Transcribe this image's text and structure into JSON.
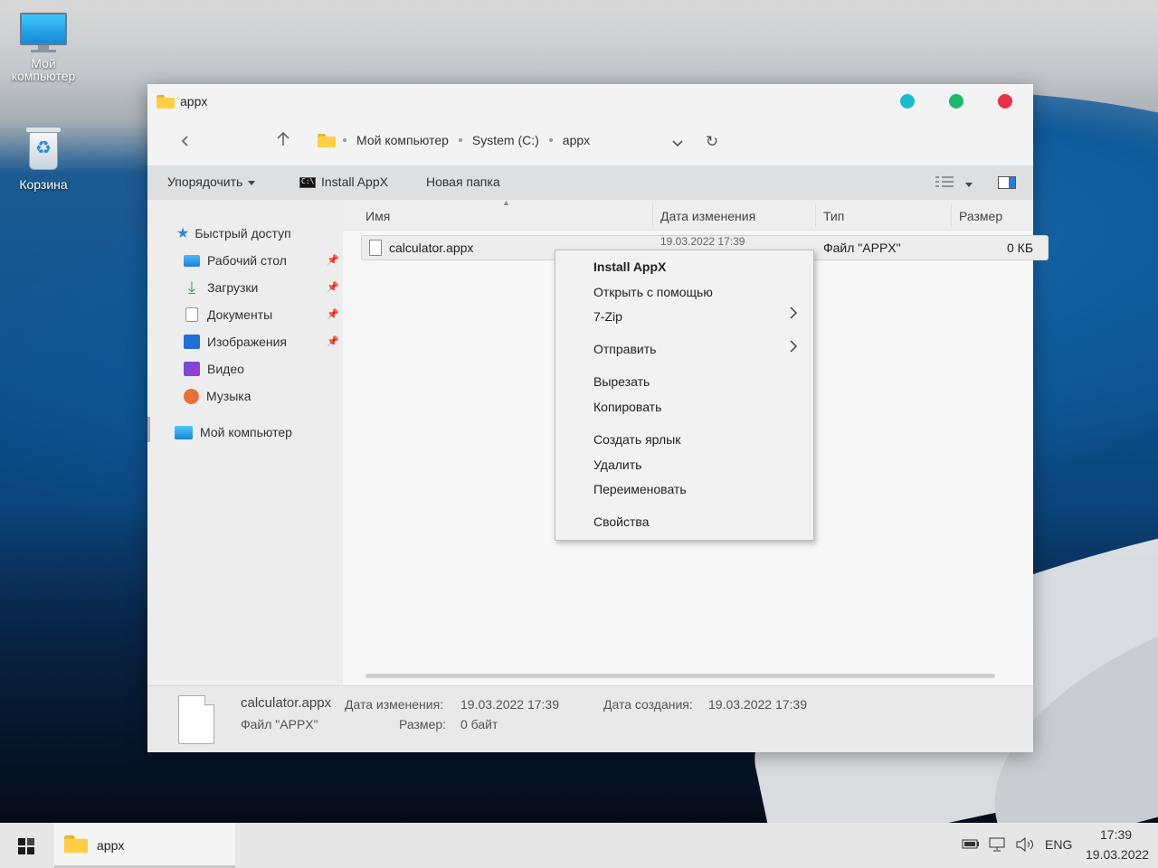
{
  "desktop": {
    "icons": [
      {
        "label_line1": "Мой",
        "label_line2": "компьютер"
      },
      {
        "label": "Корзина"
      }
    ]
  },
  "window": {
    "title": "appx",
    "controls_colors": {
      "dot1": "#1bbcd1",
      "dot2": "#1fb86a",
      "dot3": "#e8324a"
    },
    "breadcrumbs": [
      "Мой компьютер",
      "System (C:)",
      "appx"
    ],
    "commands": {
      "organize": "Упорядочить",
      "install": "Install AppX",
      "new_folder": "Новая папка"
    },
    "sidebar": {
      "quick_access": "Быстрый доступ",
      "items": [
        {
          "label": "Рабочий стол",
          "icon": "desktop-icon"
        },
        {
          "label": "Загрузки",
          "icon": "downloads-icon"
        },
        {
          "label": "Документы",
          "icon": "documents-icon"
        },
        {
          "label": "Изображения",
          "icon": "pictures-icon"
        },
        {
          "label": "Видео",
          "icon": "video-icon"
        },
        {
          "label": "Музыка",
          "icon": "music-icon"
        }
      ],
      "computer": "Мой компьютер"
    },
    "columns": {
      "name": "Имя",
      "date": "Дата изменения",
      "type": "Тип",
      "size": "Размер"
    },
    "files": [
      {
        "name": "calculator.appx",
        "date": "19.03.2022 17:39",
        "type": "Файл \"APPX\"",
        "size": "0 КБ"
      }
    ],
    "details": {
      "filename": "calculator.appx",
      "filetype": "Файл \"APPX\"",
      "modified_label": "Дата изменения:",
      "modified_value": "19.03.2022 17:39",
      "size_label": "Размер:",
      "size_value": "0 байт",
      "created_label": "Дата создания:",
      "created_value": "19.03.2022 17:39"
    }
  },
  "context_menu": {
    "items": [
      {
        "label": "Install AppX",
        "bold": true
      },
      {
        "label": "Открыть с помощью"
      },
      {
        "label": "7-Zip",
        "submenu": true
      },
      {
        "label": "Отправить",
        "submenu": true
      },
      {
        "label": "Вырезать"
      },
      {
        "label": "Копировать"
      },
      {
        "label": "Создать ярлык"
      },
      {
        "label": "Удалить"
      },
      {
        "label": "Переименовать"
      },
      {
        "label": "Свойства"
      }
    ]
  },
  "taskbar": {
    "task_label": "appx",
    "lang": "ENG",
    "time": "17:39",
    "date": "19.03.2022"
  }
}
